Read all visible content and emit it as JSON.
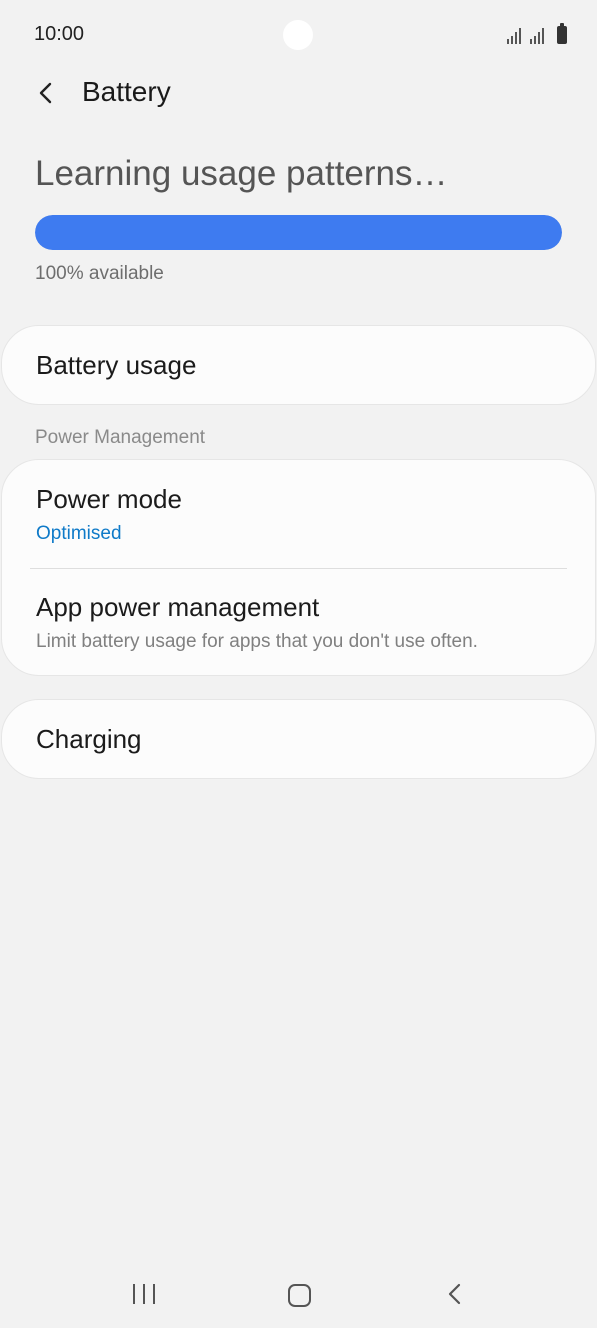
{
  "status_bar": {
    "time": "10:00"
  },
  "header": {
    "title": "Battery"
  },
  "battery": {
    "status_text": "Learning usage patterns…",
    "level_percent": 100,
    "available_text": "100% available",
    "bar_color": "#3e7bf0"
  },
  "items": {
    "battery_usage": {
      "title": "Battery usage"
    },
    "section_header": "Power Management",
    "power_mode": {
      "title": "Power mode",
      "value": "Optimised"
    },
    "app_power_management": {
      "title": "App power management",
      "subtitle": "Limit battery usage for apps that you don't use often."
    },
    "charging": {
      "title": "Charging"
    }
  },
  "colors": {
    "accent": "#0f7ac8",
    "background": "#f2f2f2"
  },
  "icons": {
    "back": "chevron-left-icon",
    "camera": "camera-cutout",
    "signal": "signal-icon",
    "battery": "battery-icon",
    "nav_recent": "recent-apps-icon",
    "nav_home": "home-icon",
    "nav_back": "back-icon"
  }
}
